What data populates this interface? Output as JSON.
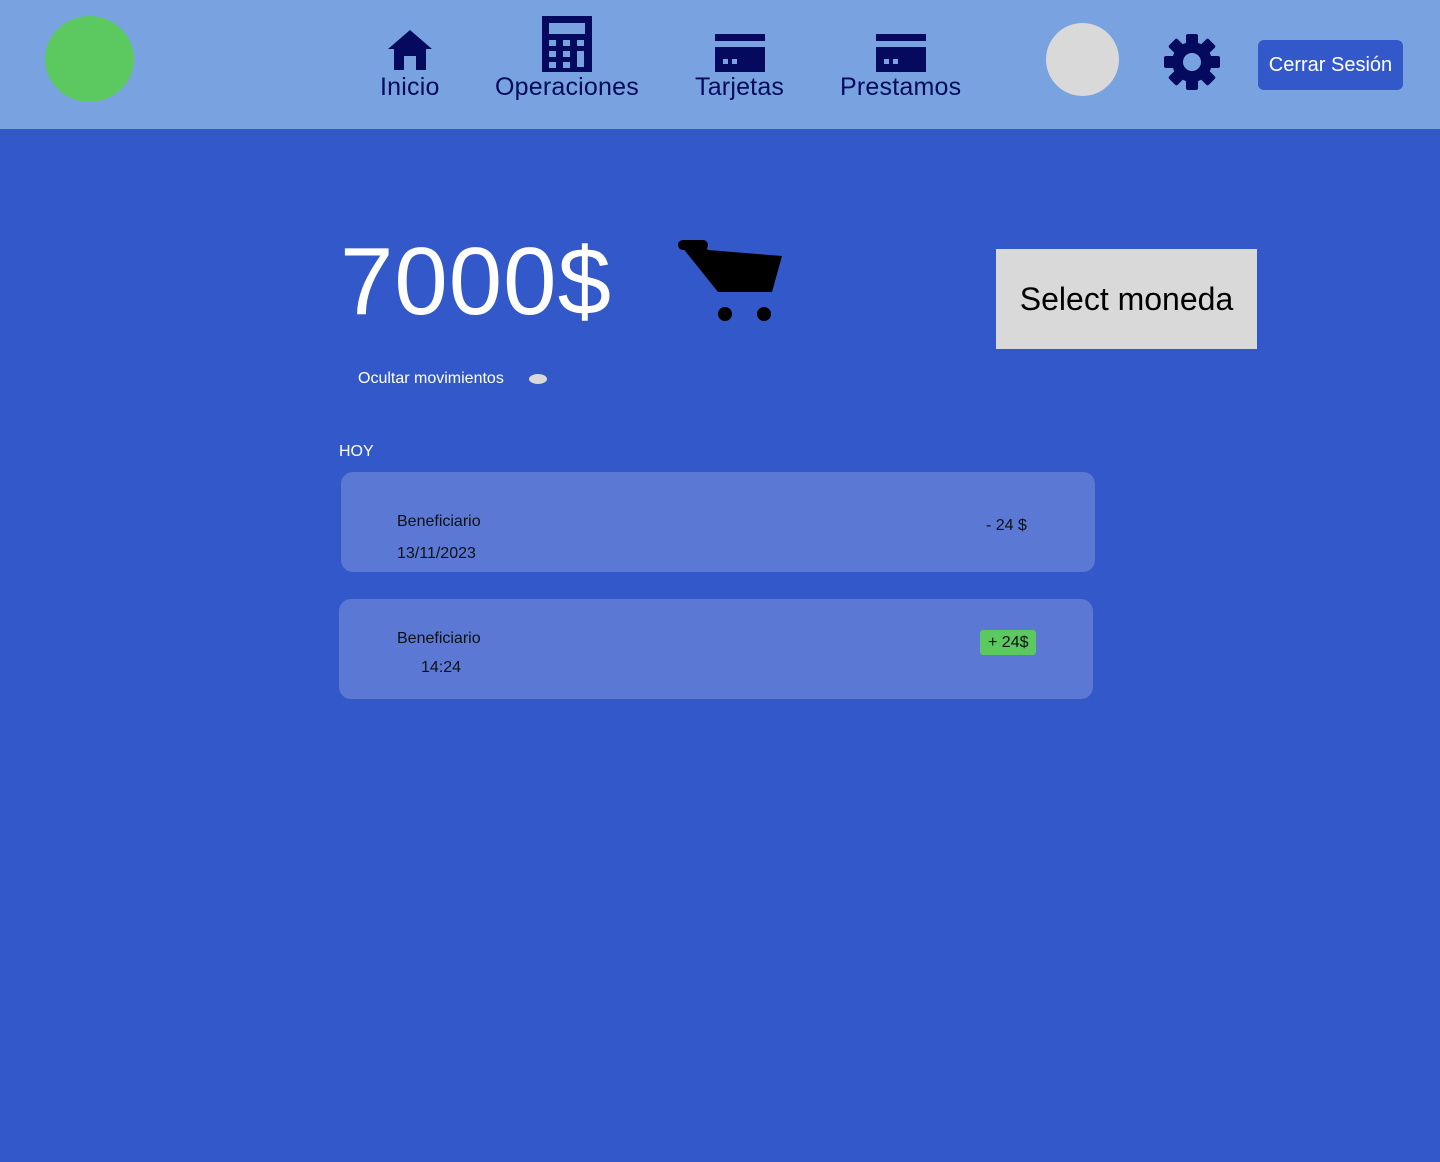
{
  "header": {
    "nav": [
      {
        "label": "Inicio",
        "icon": "home-icon"
      },
      {
        "label": "Operaciones",
        "icon": "calculator-icon"
      },
      {
        "label": "Tarjetas",
        "icon": "credit-card-icon"
      },
      {
        "label": "Prestamos",
        "icon": "credit-card-icon"
      }
    ],
    "logout_label": "Cerrar Sesión",
    "settings_icon": "gear-icon"
  },
  "account": {
    "balance": "7000$",
    "cart_icon": "cart-icon",
    "currency_select": "Select moneda",
    "hide_movements_label": "Ocultar movimientos"
  },
  "movements": {
    "section_label": "HOY",
    "items": [
      {
        "name": "Beneficiario",
        "meta": "13/11/2023",
        "amount": "- 24 $",
        "type": "debit"
      },
      {
        "name": "Beneficiario",
        "meta": "14:24",
        "amount": "+ 24$",
        "type": "credit"
      }
    ]
  },
  "colors": {
    "background": "#3358c9",
    "topbar": "#79a3e0",
    "nav_text": "#050a5e",
    "accent_green": "#5bc860",
    "card": "#5a78d4",
    "neutral": "#d9d9d9"
  }
}
